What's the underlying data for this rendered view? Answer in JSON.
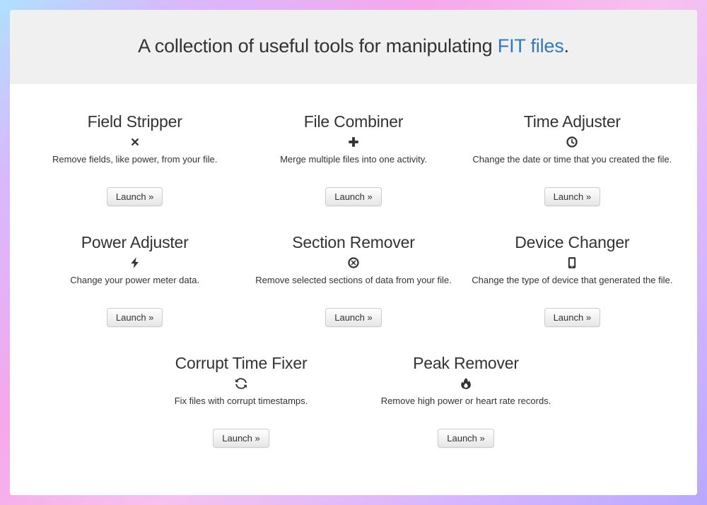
{
  "header": {
    "prefix": "A collection of useful tools for manipulating ",
    "link_text": "FIT files",
    "suffix": "."
  },
  "launch_label": "Launch »",
  "tools": [
    {
      "title": "Field Stripper",
      "icon": "remove-icon",
      "desc": "Remove fields, like power, from your file."
    },
    {
      "title": "File Combiner",
      "icon": "plus-icon",
      "desc": "Merge multiple files into one activity."
    },
    {
      "title": "Time Adjuster",
      "icon": "clock-icon",
      "desc": "Change the date or time that you created the file."
    },
    {
      "title": "Power Adjuster",
      "icon": "bolt-icon",
      "desc": "Change your power meter data."
    },
    {
      "title": "Section Remover",
      "icon": "circle-x-icon",
      "desc": "Remove selected sections of data from your file."
    },
    {
      "title": "Device Changer",
      "icon": "mobile-icon",
      "desc": "Change the type of device that generated the file."
    },
    {
      "title": "Corrupt Time Fixer",
      "icon": "refresh-icon",
      "desc": "Fix files with corrupt timestamps."
    },
    {
      "title": "Peak Remover",
      "icon": "fire-icon",
      "desc": "Remove high power or heart rate records."
    }
  ]
}
